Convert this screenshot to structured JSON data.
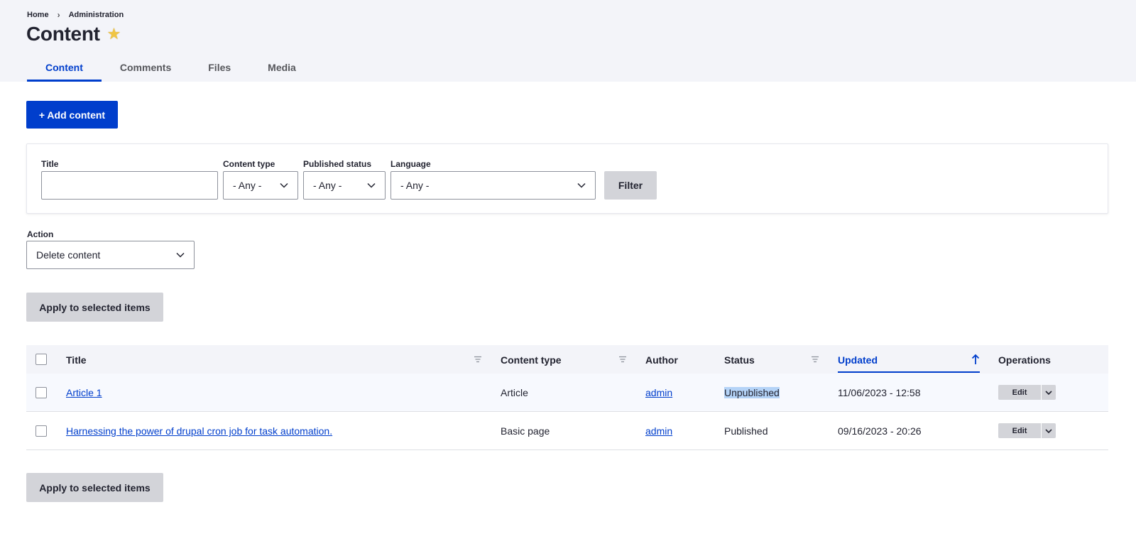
{
  "breadcrumb": {
    "home": "Home",
    "separator": "›",
    "admin": "Administration"
  },
  "page": {
    "title": "Content",
    "star_icon": "star-icon",
    "star_color": "#f0c544"
  },
  "tabs": [
    {
      "label": "Content",
      "active": true
    },
    {
      "label": "Comments",
      "active": false
    },
    {
      "label": "Files",
      "active": false
    },
    {
      "label": "Media",
      "active": false
    }
  ],
  "add_button": {
    "label": "+ Add content",
    "color": "#003ecc"
  },
  "filters": {
    "title": {
      "label": "Title",
      "value": ""
    },
    "content_type": {
      "label": "Content type",
      "value": "- Any -"
    },
    "published_status": {
      "label": "Published status",
      "value": "- Any -"
    },
    "language": {
      "label": "Language",
      "value": "- Any -"
    },
    "filter_button": "Filter"
  },
  "action": {
    "label": "Action",
    "value": "Delete content",
    "apply_label": "Apply to selected items"
  },
  "table": {
    "headers": {
      "title": "Title",
      "content_type": "Content type",
      "author": "Author",
      "status": "Status",
      "updated": "Updated",
      "operations": "Operations"
    },
    "sorted_column": "Updated",
    "sort_direction": "ascending",
    "rows": [
      {
        "title": "Article 1",
        "content_type": "Article",
        "author": "admin",
        "status": "Unpublished",
        "updated": "11/06/2023 - 12:58",
        "op": "Edit"
      },
      {
        "title": "Harnessing the power of drupal cron job for task automation.",
        "content_type": "Basic page",
        "author": "admin",
        "status": "Published",
        "updated": "09/16/2023 - 20:26",
        "op": "Edit"
      }
    ]
  },
  "bottom": {
    "apply_label": "Apply to selected items"
  },
  "colors": {
    "accent": "#003ecc",
    "header_bg": "#f3f4f9",
    "button_gray": "#d3d4d9"
  }
}
